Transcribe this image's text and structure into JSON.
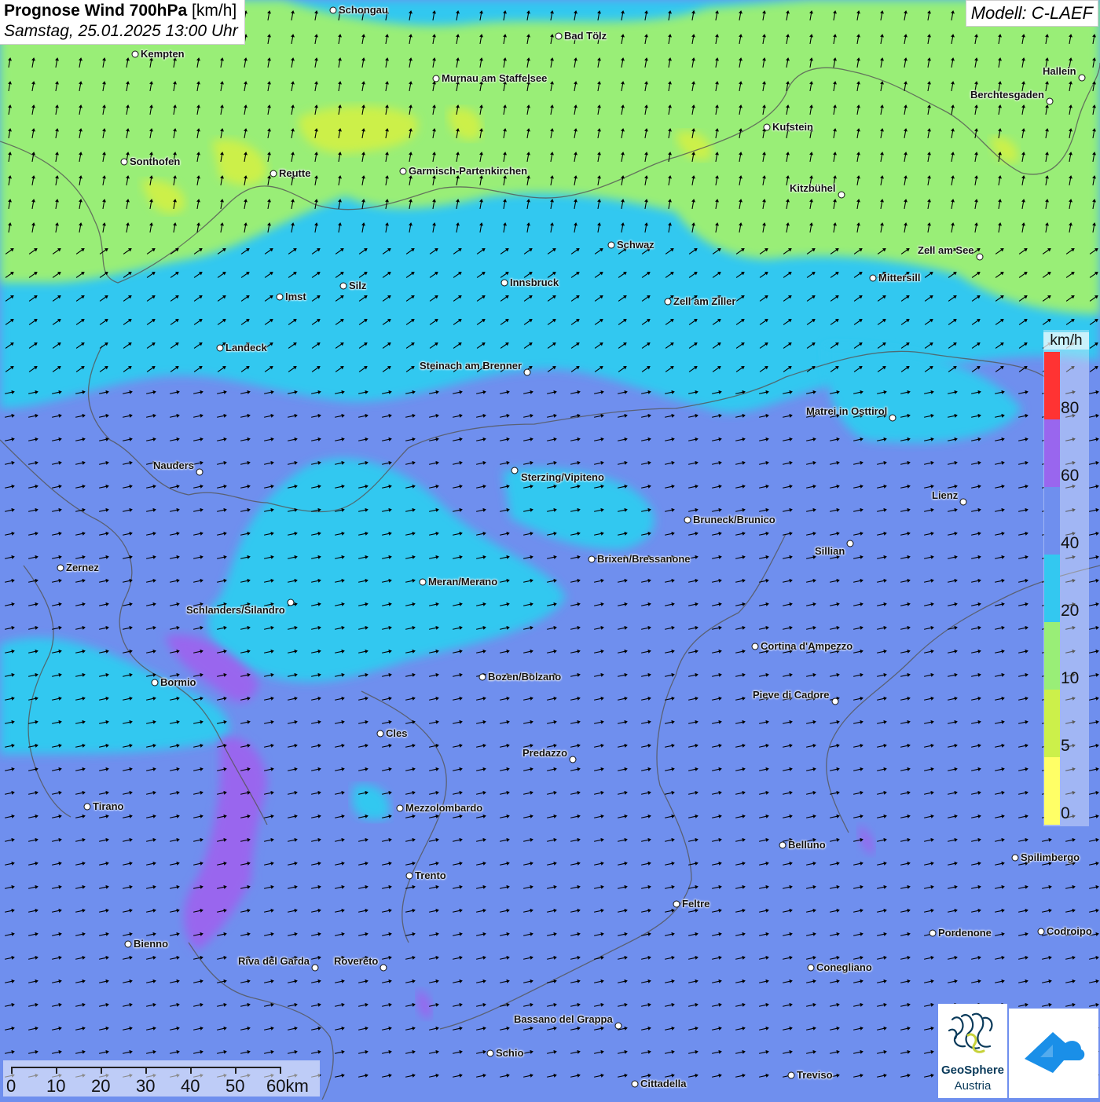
{
  "header": {
    "title_bold": "Prognose Wind 700hPa",
    "title_unit": "[km/h]",
    "datetime": "Samstag, 25.01.2025 13:00 Uhr"
  },
  "model_label": "Modell: C-LAEF",
  "colors": {
    "wind_0": "#ffff66",
    "wind_5": "#ccf04a",
    "wind_10": "#99ee77",
    "wind_20": "#33c8f0",
    "wind_40": "#6f8fee",
    "wind_60": "#9966ee",
    "wind_80": "#ff3333",
    "wind_max": "#e8f8ff",
    "borders": "#555555"
  },
  "legend": {
    "unit": "km/h",
    "ticks": [
      "0",
      "5",
      "10",
      "20",
      "40",
      "60",
      "80"
    ]
  },
  "scale_bar": {
    "labels": [
      "0",
      "10",
      "20",
      "30",
      "40",
      "50",
      "60km"
    ]
  },
  "logo": {
    "name": "GeoSphere",
    "sub": "Austria"
  },
  "cities": [
    {
      "name": "Schongau"
    },
    {
      "name": "Bad Tölz"
    },
    {
      "name": "Kempten"
    },
    {
      "name": "Murnau am Staffelsee"
    },
    {
      "name": "Hallein"
    },
    {
      "name": "Berchtesgaden"
    },
    {
      "name": "Kufstein"
    },
    {
      "name": "Sonthofen"
    },
    {
      "name": "Reutte"
    },
    {
      "name": "Garmisch-Partenkirchen"
    },
    {
      "name": "Kitzbühel"
    },
    {
      "name": "Schwaz"
    },
    {
      "name": "Zell am See"
    },
    {
      "name": "Mittersill"
    },
    {
      "name": "Imst"
    },
    {
      "name": "Silz"
    },
    {
      "name": "Innsbruck"
    },
    {
      "name": "Zell am Ziller"
    },
    {
      "name": "Landeck"
    },
    {
      "name": "Steinach am Brenner"
    },
    {
      "name": "Matrei in Osttirol"
    },
    {
      "name": "Nauders"
    },
    {
      "name": "Sterzing/Vipiteno"
    },
    {
      "name": "Lienz"
    },
    {
      "name": "Bruneck/Brunico"
    },
    {
      "name": "Sillian"
    },
    {
      "name": "Zernez"
    },
    {
      "name": "Brixen/Bressanone"
    },
    {
      "name": "Meran/Merano"
    },
    {
      "name": "Schlanders/Silandro"
    },
    {
      "name": "Cortina d'Ampezzo"
    },
    {
      "name": "Bozen/Bolzano"
    },
    {
      "name": "Bormio"
    },
    {
      "name": "Pieve di Cadore"
    },
    {
      "name": "Cles"
    },
    {
      "name": "Predazzo"
    },
    {
      "name": "Tirano"
    },
    {
      "name": "Mezzolombardo"
    },
    {
      "name": "Belluno"
    },
    {
      "name": "Spilimbergo"
    },
    {
      "name": "Trento"
    },
    {
      "name": "Feltre"
    },
    {
      "name": "Pordenone"
    },
    {
      "name": "Codroipo"
    },
    {
      "name": "Bienno"
    },
    {
      "name": "Riva del Garda"
    },
    {
      "name": "Rovereto"
    },
    {
      "name": "Conegliano"
    },
    {
      "name": "Bassano del Grappa"
    },
    {
      "name": "Schio"
    },
    {
      "name": "Treviso"
    },
    {
      "name": "Cittadella"
    }
  ]
}
